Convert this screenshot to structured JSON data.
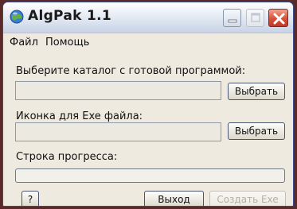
{
  "window": {
    "title": "AlgPak 1.1",
    "app_icon": "globe-icon",
    "controls": [
      "minimize-icon",
      "maximize-icon",
      "close-icon"
    ]
  },
  "menu": {
    "items": [
      {
        "label": "Файл"
      },
      {
        "label": "Помощь"
      }
    ]
  },
  "program_dir": {
    "label": "Выберите каталог с готовой программой:",
    "value": "",
    "button": "Выбрать"
  },
  "exe_icon": {
    "label": "Иконка для Exe файла:",
    "value": "",
    "button": "Выбрать"
  },
  "progress": {
    "label": "Строка прогресса:",
    "value": 0
  },
  "footer": {
    "help_button": "?",
    "exit_button": "Выход",
    "create_button": "Создать Exe"
  },
  "colors": {
    "close_button": "#d4513a",
    "window_bg": "#eeeae0",
    "progress_fill": "#3fae4a"
  }
}
